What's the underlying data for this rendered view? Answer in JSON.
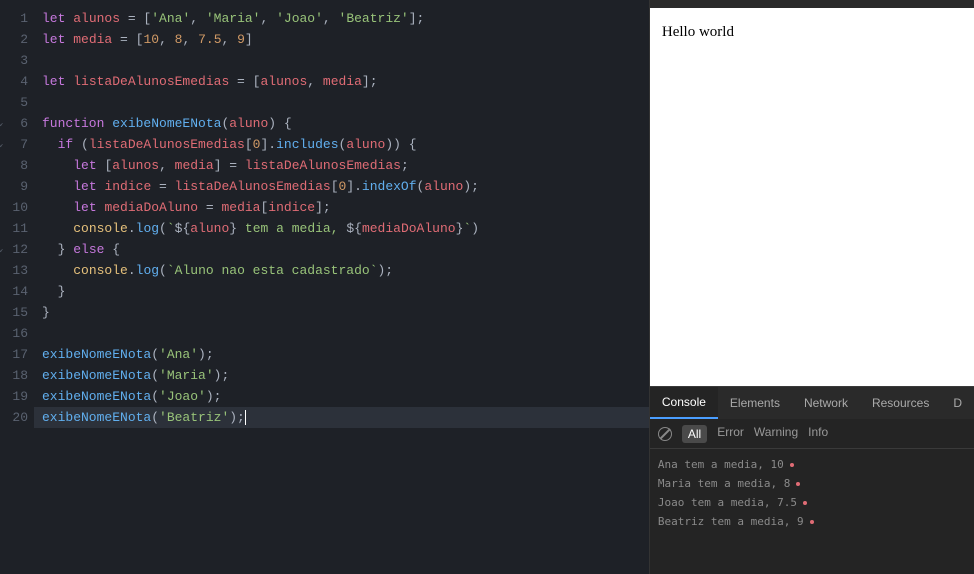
{
  "editor": {
    "lineCount": 20,
    "activeLine": 20,
    "foldLines": [
      6,
      7,
      12
    ],
    "lines": [
      {
        "n": 1,
        "tokens": [
          {
            "t": "let ",
            "c": "kw"
          },
          {
            "t": "alunos",
            "c": "var"
          },
          {
            "t": " = [",
            "c": "punct"
          },
          {
            "t": "'Ana'",
            "c": "str"
          },
          {
            "t": ", ",
            "c": "punct"
          },
          {
            "t": "'Maria'",
            "c": "str"
          },
          {
            "t": ", ",
            "c": "punct"
          },
          {
            "t": "'Joao'",
            "c": "str"
          },
          {
            "t": ", ",
            "c": "punct"
          },
          {
            "t": "'Beatriz'",
            "c": "str"
          },
          {
            "t": "];",
            "c": "punct"
          }
        ]
      },
      {
        "n": 2,
        "tokens": [
          {
            "t": "let ",
            "c": "kw"
          },
          {
            "t": "media",
            "c": "var"
          },
          {
            "t": " = [",
            "c": "punct"
          },
          {
            "t": "10",
            "c": "num"
          },
          {
            "t": ", ",
            "c": "punct"
          },
          {
            "t": "8",
            "c": "num"
          },
          {
            "t": ", ",
            "c": "punct"
          },
          {
            "t": "7.5",
            "c": "num"
          },
          {
            "t": ", ",
            "c": "punct"
          },
          {
            "t": "9",
            "c": "num"
          },
          {
            "t": "]",
            "c": "punct"
          }
        ]
      },
      {
        "n": 3,
        "tokens": []
      },
      {
        "n": 4,
        "tokens": [
          {
            "t": "let ",
            "c": "kw"
          },
          {
            "t": "listaDeAlunosEmedias",
            "c": "var"
          },
          {
            "t": " = [",
            "c": "punct"
          },
          {
            "t": "alunos",
            "c": "var"
          },
          {
            "t": ", ",
            "c": "punct"
          },
          {
            "t": "media",
            "c": "var"
          },
          {
            "t": "];",
            "c": "punct"
          }
        ]
      },
      {
        "n": 5,
        "tokens": []
      },
      {
        "n": 6,
        "tokens": [
          {
            "t": "function ",
            "c": "kw"
          },
          {
            "t": "exibeNomeENota",
            "c": "fn"
          },
          {
            "t": "(",
            "c": "punct"
          },
          {
            "t": "aluno",
            "c": "param"
          },
          {
            "t": ") {",
            "c": "punct"
          }
        ]
      },
      {
        "n": 7,
        "indent": 1,
        "tokens": [
          {
            "t": "if ",
            "c": "kw"
          },
          {
            "t": "(",
            "c": "punct"
          },
          {
            "t": "listaDeAlunosEmedias",
            "c": "var"
          },
          {
            "t": "[",
            "c": "punct"
          },
          {
            "t": "0",
            "c": "num"
          },
          {
            "t": "].",
            "c": "punct"
          },
          {
            "t": "includes",
            "c": "fn"
          },
          {
            "t": "(",
            "c": "punct"
          },
          {
            "t": "aluno",
            "c": "var"
          },
          {
            "t": ")) {",
            "c": "punct"
          }
        ]
      },
      {
        "n": 8,
        "indent": 2,
        "tokens": [
          {
            "t": "let ",
            "c": "kw"
          },
          {
            "t": "[",
            "c": "punct"
          },
          {
            "t": "alunos",
            "c": "var"
          },
          {
            "t": ", ",
            "c": "punct"
          },
          {
            "t": "media",
            "c": "var"
          },
          {
            "t": "] = ",
            "c": "punct"
          },
          {
            "t": "listaDeAlunosEmedias",
            "c": "var"
          },
          {
            "t": ";",
            "c": "punct"
          }
        ]
      },
      {
        "n": 9,
        "indent": 2,
        "tokens": [
          {
            "t": "let ",
            "c": "kw"
          },
          {
            "t": "indice",
            "c": "var"
          },
          {
            "t": " = ",
            "c": "punct"
          },
          {
            "t": "listaDeAlunosEmedias",
            "c": "var"
          },
          {
            "t": "[",
            "c": "punct"
          },
          {
            "t": "0",
            "c": "num"
          },
          {
            "t": "].",
            "c": "punct"
          },
          {
            "t": "indexOf",
            "c": "fn"
          },
          {
            "t": "(",
            "c": "punct"
          },
          {
            "t": "aluno",
            "c": "var"
          },
          {
            "t": ");",
            "c": "punct"
          }
        ]
      },
      {
        "n": 10,
        "indent": 2,
        "tokens": [
          {
            "t": "let ",
            "c": "kw"
          },
          {
            "t": "mediaDoAluno",
            "c": "var"
          },
          {
            "t": " = ",
            "c": "punct"
          },
          {
            "t": "media",
            "c": "var"
          },
          {
            "t": "[",
            "c": "punct"
          },
          {
            "t": "indice",
            "c": "var"
          },
          {
            "t": "];",
            "c": "punct"
          }
        ]
      },
      {
        "n": 11,
        "indent": 2,
        "tokens": [
          {
            "t": "console",
            "c": "prop"
          },
          {
            "t": ".",
            "c": "punct"
          },
          {
            "t": "log",
            "c": "fn"
          },
          {
            "t": "(",
            "c": "punct"
          },
          {
            "t": "`",
            "c": "tmpl"
          },
          {
            "t": "${",
            "c": "punct"
          },
          {
            "t": "aluno",
            "c": "tmplvar"
          },
          {
            "t": "}",
            "c": "punct"
          },
          {
            "t": " tem a media, ",
            "c": "tmpl"
          },
          {
            "t": "${",
            "c": "punct"
          },
          {
            "t": "mediaDoAluno",
            "c": "tmplvar"
          },
          {
            "t": "}",
            "c": "punct"
          },
          {
            "t": "`",
            "c": "tmpl"
          },
          {
            "t": ")",
            "c": "punct"
          }
        ]
      },
      {
        "n": 12,
        "indent": 1,
        "tokens": [
          {
            "t": "} ",
            "c": "punct"
          },
          {
            "t": "else ",
            "c": "kw"
          },
          {
            "t": "{",
            "c": "punct"
          }
        ]
      },
      {
        "n": 13,
        "indent": 2,
        "tokens": [
          {
            "t": "console",
            "c": "prop"
          },
          {
            "t": ".",
            "c": "punct"
          },
          {
            "t": "log",
            "c": "fn"
          },
          {
            "t": "(",
            "c": "punct"
          },
          {
            "t": "`Aluno nao esta cadastrado`",
            "c": "tmpl"
          },
          {
            "t": ");",
            "c": "punct"
          }
        ]
      },
      {
        "n": 14,
        "indent": 1,
        "tokens": [
          {
            "t": "}",
            "c": "punct"
          }
        ]
      },
      {
        "n": 15,
        "tokens": [
          {
            "t": "}",
            "c": "punct"
          }
        ]
      },
      {
        "n": 16,
        "tokens": []
      },
      {
        "n": 17,
        "tokens": [
          {
            "t": "exibeNomeENota",
            "c": "fn"
          },
          {
            "t": "(",
            "c": "punct"
          },
          {
            "t": "'Ana'",
            "c": "str"
          },
          {
            "t": ");",
            "c": "punct"
          }
        ]
      },
      {
        "n": 18,
        "tokens": [
          {
            "t": "exibeNomeENota",
            "c": "fn"
          },
          {
            "t": "(",
            "c": "punct"
          },
          {
            "t": "'Maria'",
            "c": "str"
          },
          {
            "t": ");",
            "c": "punct"
          }
        ]
      },
      {
        "n": 19,
        "tokens": [
          {
            "t": "exibeNomeENota",
            "c": "fn"
          },
          {
            "t": "(",
            "c": "punct"
          },
          {
            "t": "'Joao'",
            "c": "str"
          },
          {
            "t": ");",
            "c": "punct"
          }
        ]
      },
      {
        "n": 20,
        "tokens": [
          {
            "t": "exibeNomeENota",
            "c": "fn"
          },
          {
            "t": "(",
            "c": "punct"
          },
          {
            "t": "'Beatriz'",
            "c": "str"
          },
          {
            "t": ");",
            "c": "punct"
          }
        ],
        "cursor": true
      }
    ]
  },
  "output": {
    "text": "Hello world"
  },
  "devtools": {
    "tabs": [
      "Console",
      "Elements",
      "Network",
      "Resources",
      "D"
    ],
    "activeTab": 0,
    "filters": [
      "All",
      "Error",
      "Warning",
      "Info"
    ],
    "activeFilter": 0,
    "logs": [
      "Ana tem a media, 10",
      "Maria tem a media, 8",
      "Joao tem a media, 7.5",
      "Beatriz tem a media, 9"
    ]
  }
}
